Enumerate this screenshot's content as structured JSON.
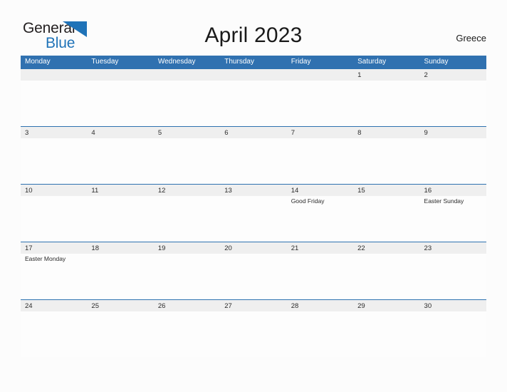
{
  "logo": {
    "word_one": "General",
    "word_two": "Blue",
    "flag_icon": "blue-flag-triangle-icon",
    "dark_color": "#231f20",
    "blue_color": "#1f73b8"
  },
  "header": {
    "title": "April 2023",
    "country": "Greece"
  },
  "theme": {
    "header_blue": "#3071b0",
    "row_divider_blue": "#2e72b0",
    "number_band_gray": "#efefef",
    "cell_white": "#fdfdfd",
    "page_background": "#fcfcfc"
  },
  "calendar": {
    "month": "April",
    "year": "2023",
    "weekday_headers": [
      "Monday",
      "Tuesday",
      "Wednesday",
      "Thursday",
      "Friday",
      "Saturday",
      "Sunday"
    ],
    "weeks": [
      [
        {
          "day": "",
          "event": ""
        },
        {
          "day": "",
          "event": ""
        },
        {
          "day": "",
          "event": ""
        },
        {
          "day": "",
          "event": ""
        },
        {
          "day": "",
          "event": ""
        },
        {
          "day": "1",
          "event": ""
        },
        {
          "day": "2",
          "event": ""
        }
      ],
      [
        {
          "day": "3",
          "event": ""
        },
        {
          "day": "4",
          "event": ""
        },
        {
          "day": "5",
          "event": ""
        },
        {
          "day": "6",
          "event": ""
        },
        {
          "day": "7",
          "event": ""
        },
        {
          "day": "8",
          "event": ""
        },
        {
          "day": "9",
          "event": ""
        }
      ],
      [
        {
          "day": "10",
          "event": ""
        },
        {
          "day": "11",
          "event": ""
        },
        {
          "day": "12",
          "event": ""
        },
        {
          "day": "13",
          "event": ""
        },
        {
          "day": "14",
          "event": "Good Friday"
        },
        {
          "day": "15",
          "event": ""
        },
        {
          "day": "16",
          "event": "Easter Sunday"
        }
      ],
      [
        {
          "day": "17",
          "event": "Easter Monday"
        },
        {
          "day": "18",
          "event": ""
        },
        {
          "day": "19",
          "event": ""
        },
        {
          "day": "20",
          "event": ""
        },
        {
          "day": "21",
          "event": ""
        },
        {
          "day": "22",
          "event": ""
        },
        {
          "day": "23",
          "event": ""
        }
      ],
      [
        {
          "day": "24",
          "event": ""
        },
        {
          "day": "25",
          "event": ""
        },
        {
          "day": "26",
          "event": ""
        },
        {
          "day": "27",
          "event": ""
        },
        {
          "day": "28",
          "event": ""
        },
        {
          "day": "29",
          "event": ""
        },
        {
          "day": "30",
          "event": ""
        }
      ]
    ]
  }
}
